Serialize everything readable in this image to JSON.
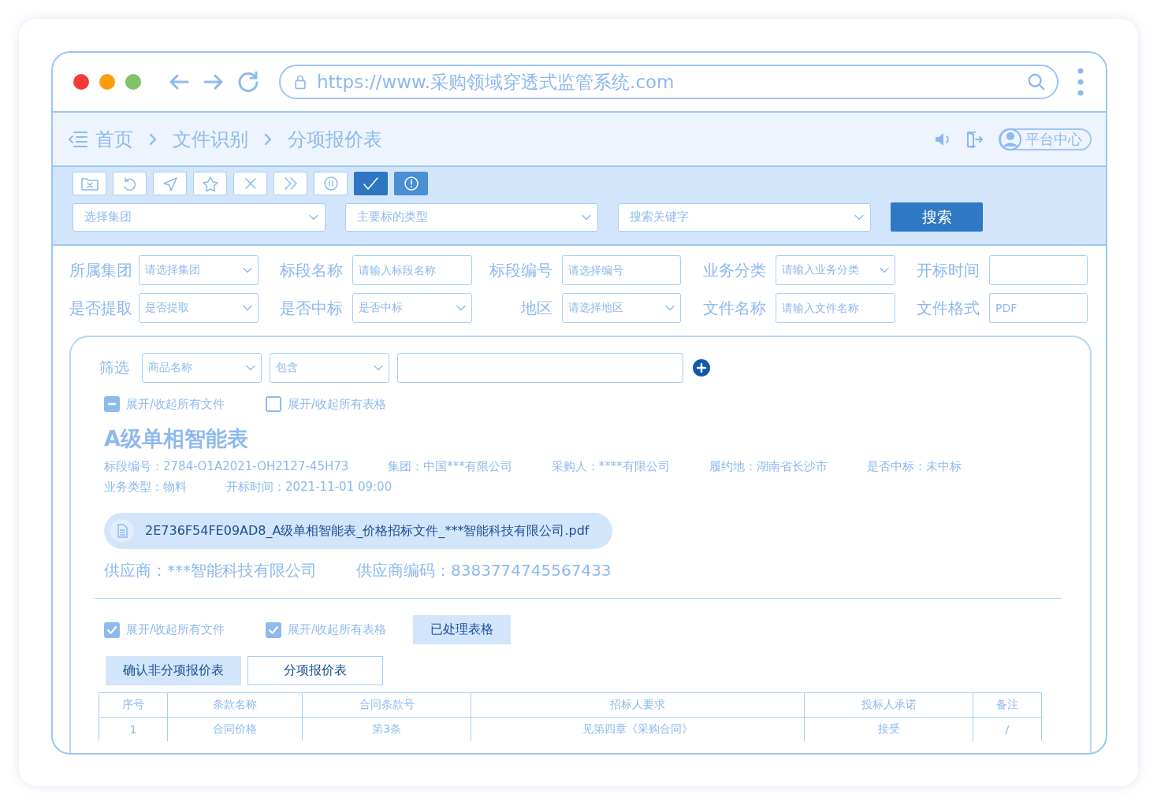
{
  "browser": {
    "url": "https://www.采购领域穿透式监管系统.com"
  },
  "breadcrumb": [
    "首页",
    "文件识别",
    "分项报价表"
  ],
  "header": {
    "user_button": "平台中心"
  },
  "toolbar": [
    {
      "kind": "folder",
      "selected": false,
      "highlighted": false
    },
    {
      "kind": "undo",
      "selected": false,
      "highlighted": false
    },
    {
      "kind": "send",
      "selected": false,
      "highlighted": false
    },
    {
      "kind": "star",
      "selected": false,
      "highlighted": false
    },
    {
      "kind": "close",
      "selected": false,
      "highlighted": false
    },
    {
      "kind": "forward",
      "selected": false,
      "highlighted": false
    },
    {
      "kind": "pause",
      "selected": false,
      "highlighted": false
    },
    {
      "kind": "check",
      "selected": true,
      "highlighted": false
    },
    {
      "kind": "alert",
      "selected": false,
      "highlighted": true
    }
  ],
  "search_bar": {
    "selects": [
      "选择集团",
      "主要标的类型",
      "搜索关键字"
    ],
    "button": "搜索"
  },
  "filters": [
    {
      "label": "所属集团",
      "kind": "select",
      "placeholder": "请选择集团"
    },
    {
      "label": "标段名称",
      "kind": "input",
      "placeholder": "请输入标段名称"
    },
    {
      "label": "标段编号",
      "kind": "input",
      "placeholder": "请选择编号"
    },
    {
      "label": "业务分类",
      "kind": "select",
      "placeholder": "请输入业务分类"
    },
    {
      "label": "开标时间",
      "kind": "input"
    },
    {
      "label": "是否提取",
      "kind": "select",
      "placeholder": "是否提取"
    },
    {
      "label": "是否中标",
      "kind": "select",
      "placeholder": "是否中标"
    },
    {
      "label": "地区",
      "kind": "select",
      "placeholder": "请选择地区"
    },
    {
      "label": "文件名称",
      "kind": "input",
      "placeholder": "请输入文件名称"
    },
    {
      "label": "文件格式",
      "kind": "input",
      "placeholder": "PDF"
    }
  ],
  "panel": {
    "filter": {
      "label": "筛选",
      "selects": [
        "商品名称",
        "包含"
      ]
    },
    "top_checks": [
      {
        "label": "展开/收起所有文件",
        "checked": true,
        "partial": true
      },
      {
        "label": "展开/收起所有表格",
        "checked": false,
        "partial": false
      }
    ],
    "title": "A级单相智能表",
    "meta_rows": [
      [
        "标段编号：2784-O1A2021-OH2127-45H73",
        "集团：中国***有限公司",
        "采购人：****有限公司",
        "履约地：湖南省长沙市",
        "是否中标：未中标"
      ],
      [
        "业务类型：物料",
        "开标时间：2021-11-01 09:00"
      ]
    ],
    "file": "2E736F54FE09AD8_A级单相智能表_价格招标文件_***智能科技有限公司.pdf",
    "supplier": [
      "供应商：***智能科技有限公司",
      "供应商编码：8383774745567433"
    ],
    "bottom_checks": [
      {
        "label": "展开/收起所有文件",
        "checked": true
      },
      {
        "label": "展开/收起所有表格",
        "checked": true
      }
    ],
    "processed_button": "已处理表格",
    "tabs": [
      {
        "label": "确认非分项报价表",
        "selected": true
      },
      {
        "label": "分项报价表",
        "selected": false
      }
    ],
    "table": {
      "columns": [
        "序号",
        "条款名称",
        "合同条款号",
        "招标人要求",
        "投标人承诺",
        "备注"
      ],
      "rows": [
        [
          "1",
          "合同价格",
          "第3条",
          "见第四章《采购合同》",
          "接受",
          "/"
        ]
      ]
    }
  }
}
